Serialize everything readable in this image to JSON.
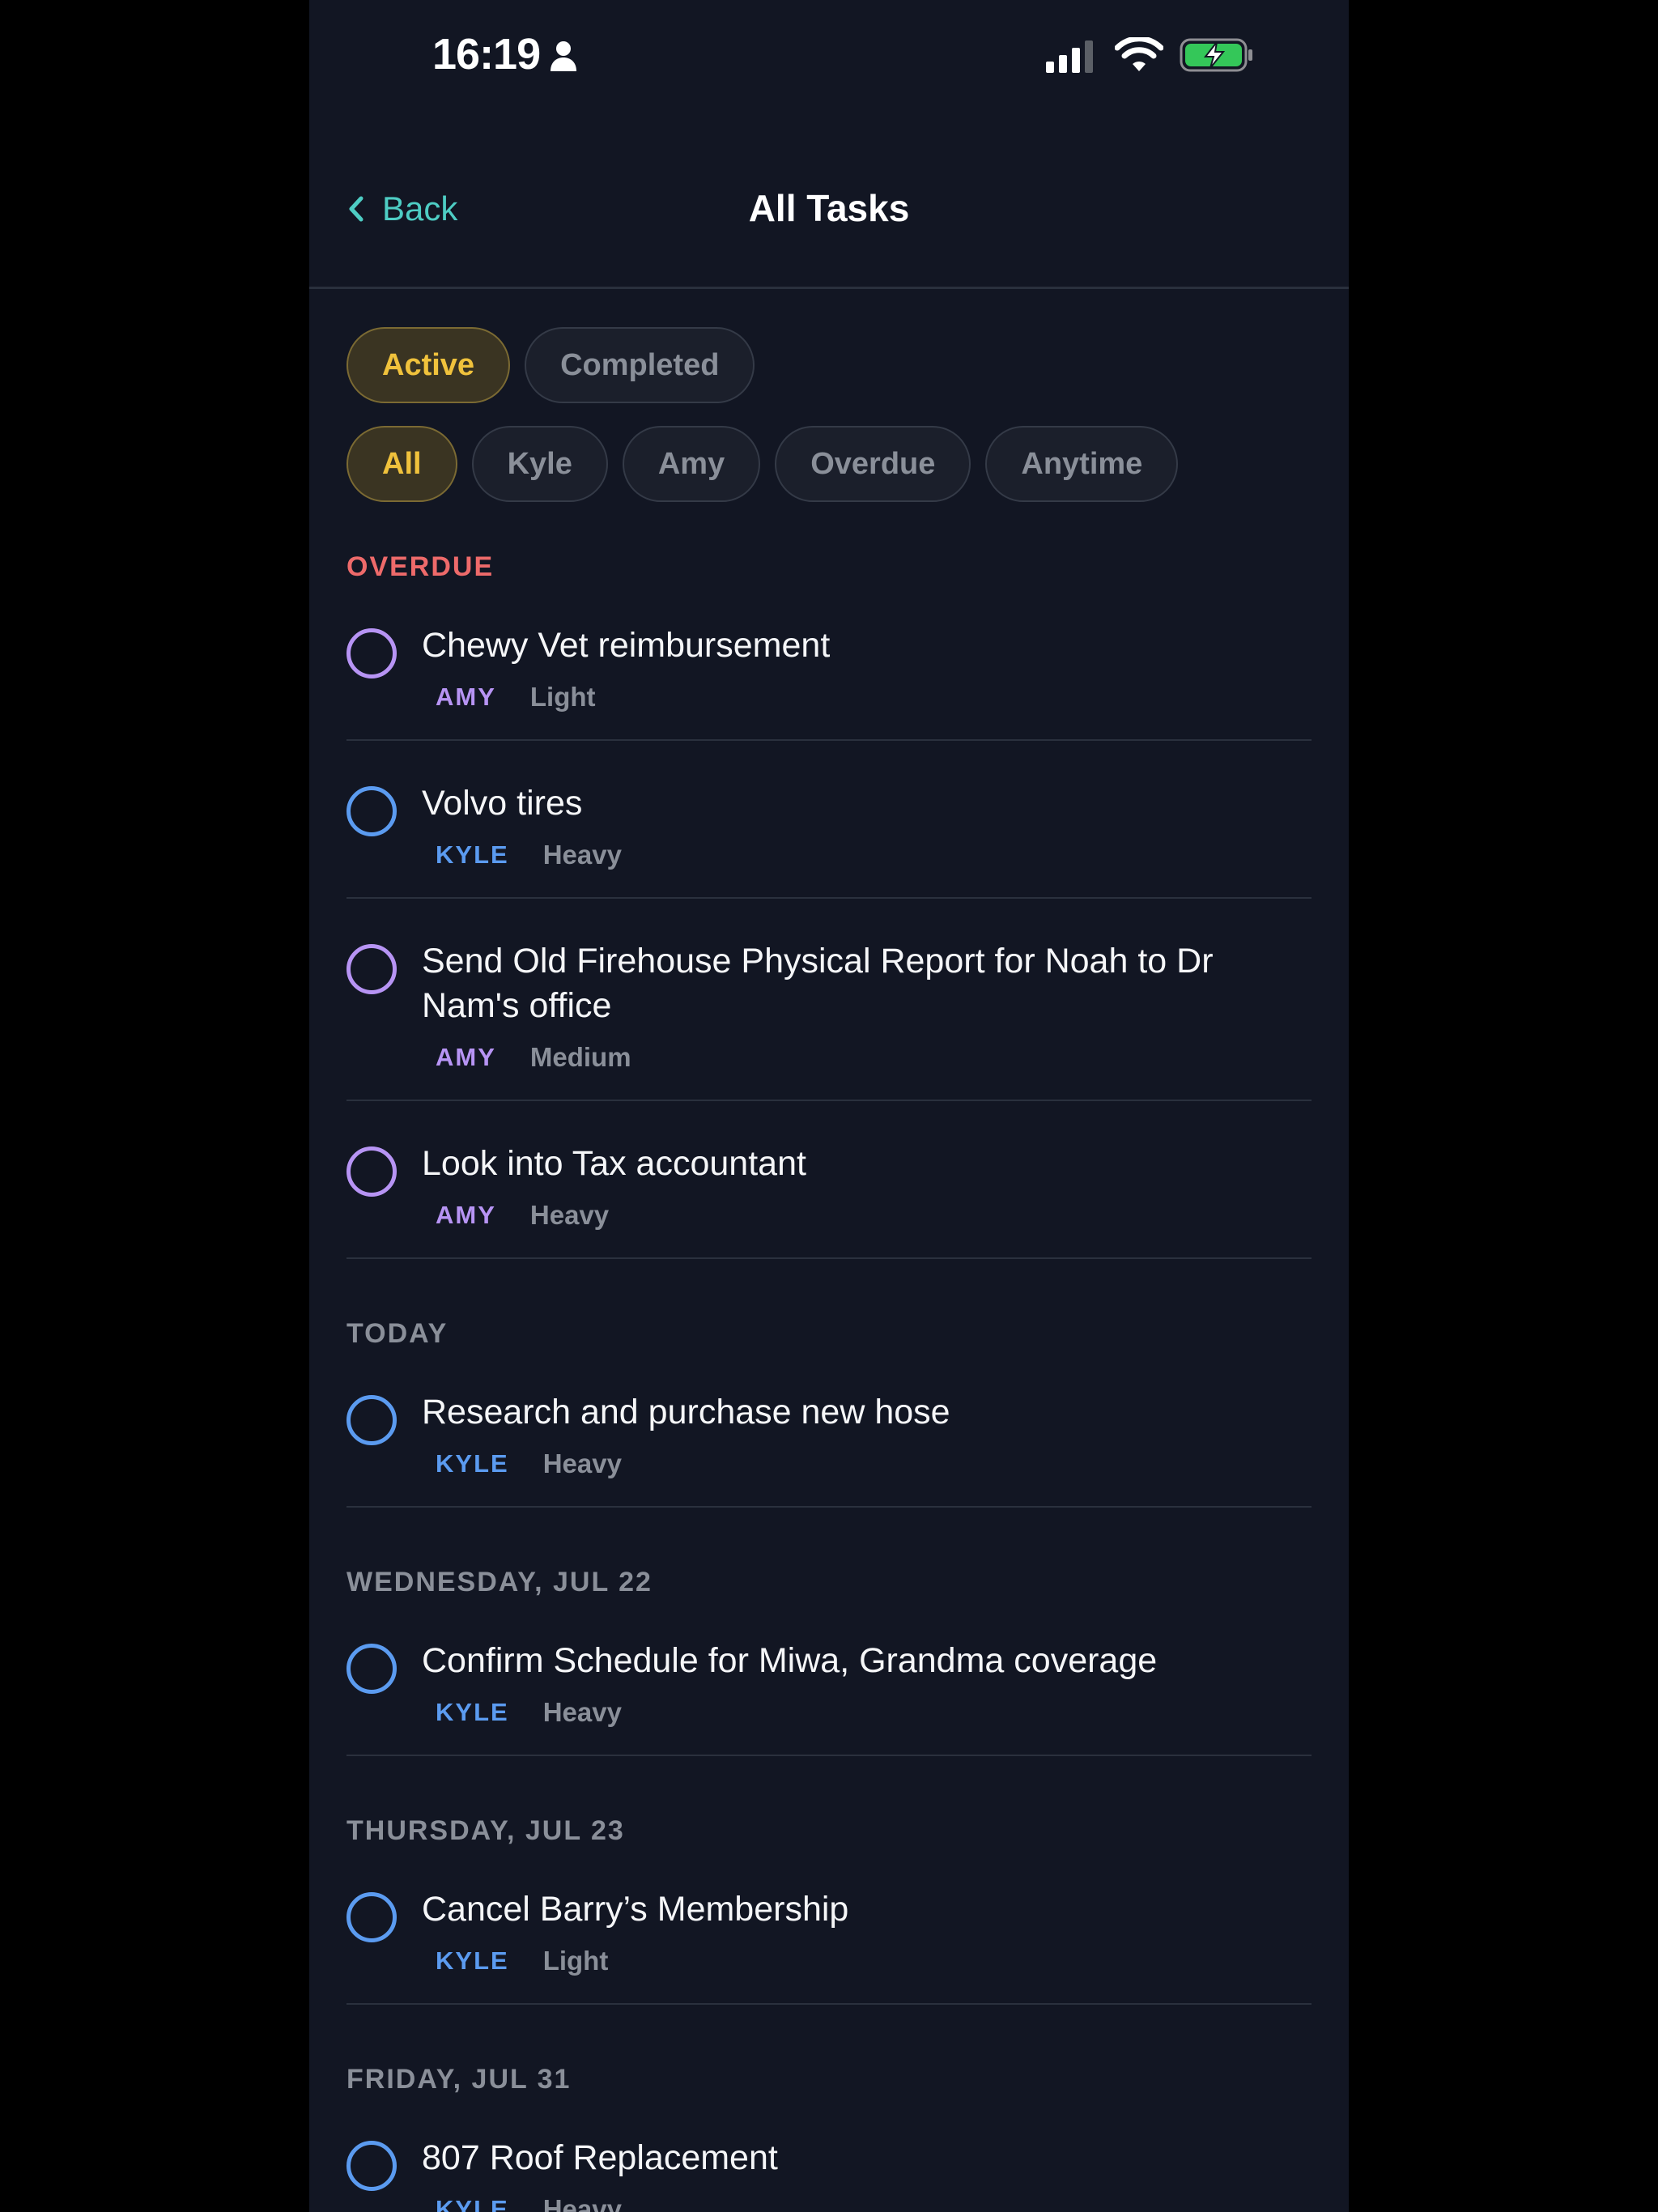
{
  "status_bar": {
    "time": "16:19",
    "icons": [
      "person-icon",
      "cellular-signal-icon",
      "wifi-icon",
      "battery-charging-icon"
    ],
    "battery_color": "#34c759"
  },
  "nav": {
    "back_label": "Back",
    "title": "All Tasks"
  },
  "status_filters": [
    {
      "label": "Active",
      "selected": true
    },
    {
      "label": "Completed",
      "selected": false
    }
  ],
  "person_filters": [
    {
      "label": "All",
      "selected": true
    },
    {
      "label": "Kyle",
      "selected": false
    },
    {
      "label": "Amy",
      "selected": false
    },
    {
      "label": "Overdue",
      "selected": false
    },
    {
      "label": "Anytime",
      "selected": false
    }
  ],
  "colors": {
    "accent_teal": "#4ecdc4",
    "selected_chip": "#f0c23c",
    "overdue": "#ee6a6a",
    "kyle": "#5b9bf0",
    "amy": "#b794f4"
  },
  "sections": [
    {
      "header": "OVERDUE",
      "tasks": [
        {
          "title": "Chewy Vet reimbursement",
          "assignee": "AMY",
          "effort": "Light"
        },
        {
          "title": "Volvo tires",
          "assignee": "KYLE",
          "effort": "Heavy"
        },
        {
          "title": "Send Old Firehouse Physical Report for Noah to Dr Nam's office",
          "assignee": "AMY",
          "effort": "Medium"
        },
        {
          "title": "Look into Tax accountant",
          "assignee": "AMY",
          "effort": "Heavy"
        }
      ]
    },
    {
      "header": "TODAY",
      "tasks": [
        {
          "title": "Research and purchase new hose",
          "assignee": "KYLE",
          "effort": "Heavy"
        }
      ]
    },
    {
      "header": "WEDNESDAY, JUL 22",
      "tasks": [
        {
          "title": "Confirm Schedule for Miwa, Grandma coverage",
          "assignee": "KYLE",
          "effort": "Heavy"
        }
      ]
    },
    {
      "header": "THURSDAY, JUL 23",
      "tasks": [
        {
          "title": "Cancel Barry’s Membership",
          "assignee": "KYLE",
          "effort": "Light"
        }
      ]
    },
    {
      "header": "FRIDAY, JUL 31",
      "tasks": [
        {
          "title": "807 Roof Replacement",
          "assignee": "KYLE",
          "effort": "Heavy"
        }
      ]
    }
  ]
}
